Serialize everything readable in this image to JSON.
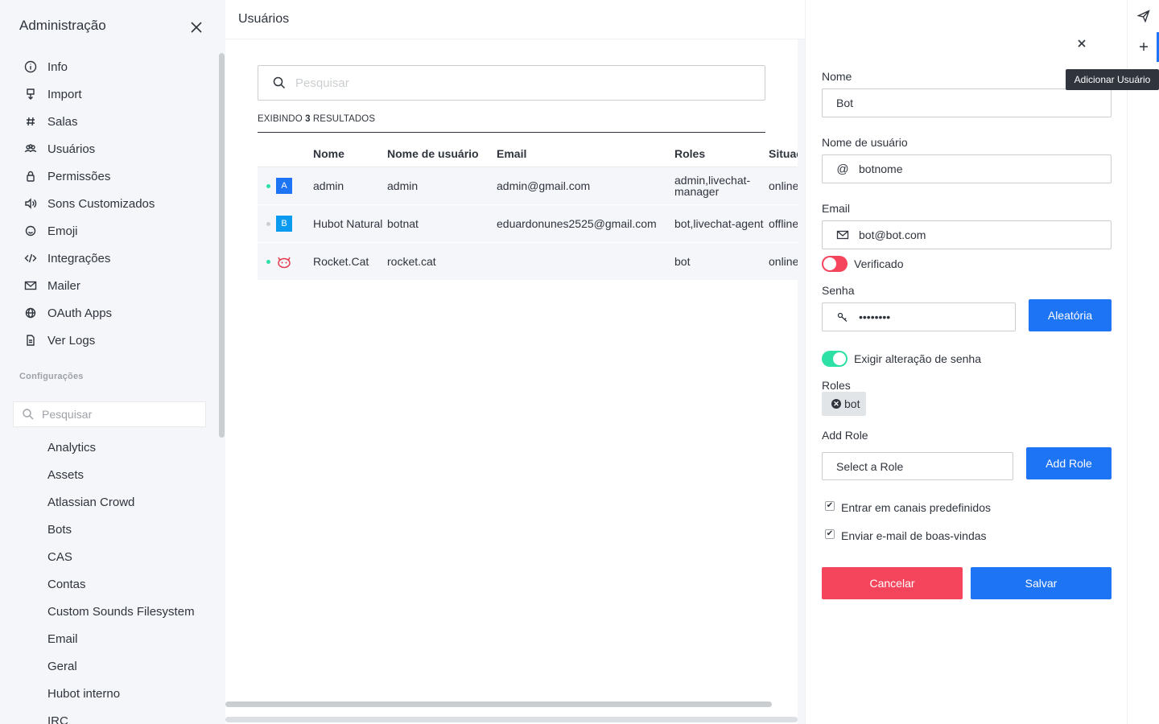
{
  "sidebar": {
    "title": "Administração",
    "nav": [
      {
        "label": "Info",
        "icon": "info-icon"
      },
      {
        "label": "Import",
        "icon": "import-icon"
      },
      {
        "label": "Salas",
        "icon": "hashtag-icon"
      },
      {
        "label": "Usuários",
        "icon": "team-icon"
      },
      {
        "label": "Permissões",
        "icon": "lock-icon"
      },
      {
        "label": "Sons Customizados",
        "icon": "volume-icon"
      },
      {
        "label": "Emoji",
        "icon": "emoji-icon"
      },
      {
        "label": "Integrações",
        "icon": "code-icon"
      },
      {
        "label": "Mailer",
        "icon": "mail-icon"
      },
      {
        "label": "OAuth Apps",
        "icon": "globe-icon"
      },
      {
        "label": "Ver Logs",
        "icon": "file-icon"
      }
    ],
    "settings_title": "Configurações",
    "search_placeholder": "Pesquisar",
    "settings": [
      "Analytics",
      "Assets",
      "Atlassian Crowd",
      "Bots",
      "CAS",
      "Contas",
      "Custom Sounds Filesystem",
      "Email",
      "Geral",
      "Hubot interno",
      "IRC"
    ]
  },
  "main": {
    "title": "Usuários",
    "search_placeholder": "Pesquisar",
    "results_prefix": "EXIBINDO ",
    "results_count": "3",
    "results_suffix": " RESULTADOS",
    "columns": [
      "Nome",
      "Nome de usuário",
      "Email",
      "Roles",
      "Situação"
    ],
    "rows": [
      {
        "status": "on",
        "avatar": "A",
        "avatar_color": "#1d74f5",
        "name": "admin",
        "username": "admin",
        "email": "admin@gmail.com",
        "roles": "admin,livechat-manager",
        "situation": "online"
      },
      {
        "status": "off",
        "avatar": "B",
        "avatar_color": "#0a9bf0",
        "name": "Hubot Natural",
        "username": "botnat",
        "email": "eduardonunes2525@gmail.com",
        "roles": "bot,livechat-agent",
        "situation": "offline"
      },
      {
        "status": "on",
        "avatar": "",
        "avatar_color": "",
        "name": "Rocket.Cat",
        "username": "rocket.cat",
        "email": "",
        "roles": "bot",
        "situation": "online"
      }
    ]
  },
  "panel": {
    "name_label": "Nome",
    "name_value": "Bot",
    "username_label": "Nome de usuário",
    "username_prefix": "@",
    "username_value": "botnome",
    "email_label": "Email",
    "email_value": "bot@bot.com",
    "verified_label": "Verificado",
    "password_label": "Senha",
    "password_value": "••••••••",
    "random_button": "Aleatória",
    "require_change_label": "Exigir alteração de senha",
    "roles_label": "Roles",
    "role_chip": "bot",
    "add_role_label": "Add Role",
    "select_role_placeholder": "Select a Role",
    "add_role_button": "Add Role",
    "join_default_label": "Entrar em canais predefinidos",
    "send_welcome_label": "Enviar e-mail de boas-vindas",
    "cancel_button": "Cancelar",
    "save_button": "Salvar"
  },
  "rail": {
    "tooltip": "Adicionar Usuário"
  },
  "colors": {
    "primary": "#1d74f5",
    "danger": "#f5455c",
    "success": "#2de0a5"
  }
}
